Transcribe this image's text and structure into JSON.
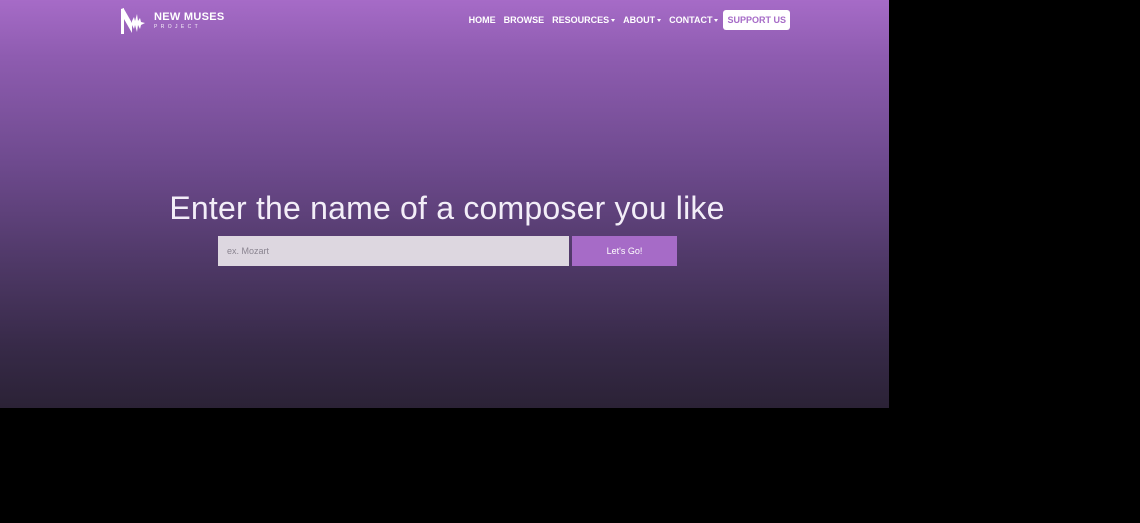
{
  "brand": {
    "name": "NEW MUSES",
    "subtitle": "PROJECT"
  },
  "nav": {
    "home": "HOME",
    "browse": "BROWSE",
    "resources": "RESOURCES",
    "about": "ABOUT",
    "contact": "CONTACT",
    "support": "SUPPORT US"
  },
  "hero": {
    "title": "Enter the name of a composer you like"
  },
  "search": {
    "placeholder": "ex. Mozart",
    "value": "",
    "button_label": "Let's Go!"
  },
  "colors": {
    "accent": "#a66bc7",
    "input_bg": "#ddd7e0",
    "page_bg": "#000000"
  },
  "icons": {
    "logo": "new-muses-logo-icon",
    "dropdown": "caret-down-icon"
  }
}
